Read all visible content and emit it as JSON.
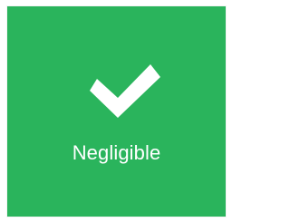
{
  "tile": {
    "background_color": "#2ab45c",
    "text_color": "#ffffff",
    "icon": "check-icon",
    "label": "Negligible"
  }
}
